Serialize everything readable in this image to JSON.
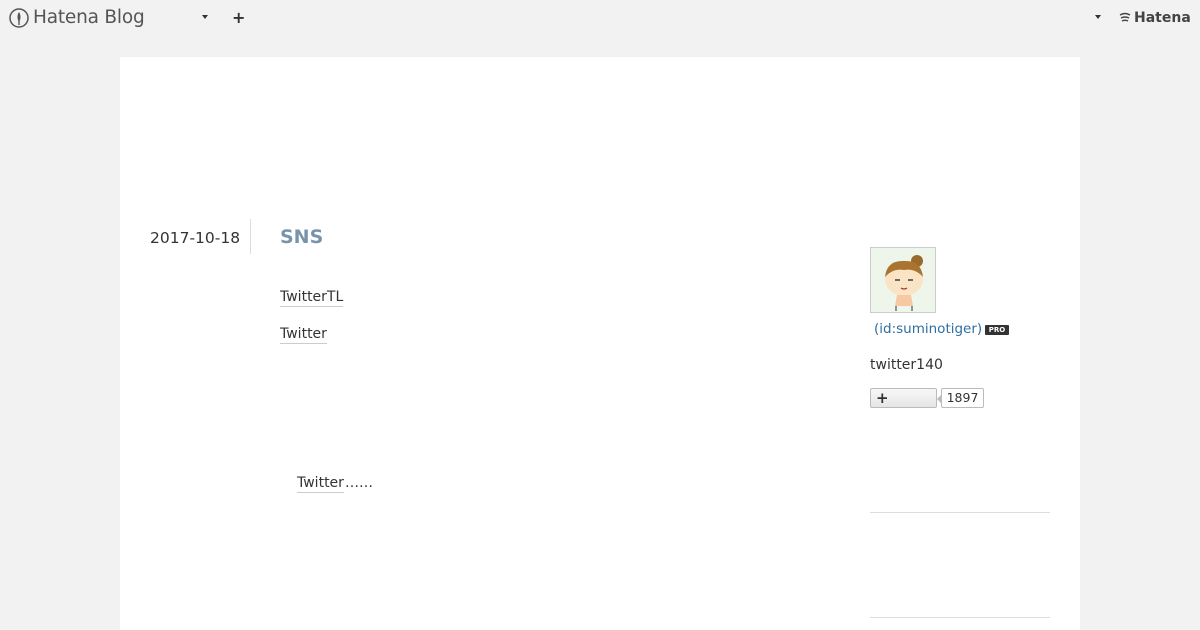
{
  "topbar": {
    "logo_text": "Hatena Blog",
    "add_label": "+",
    "hatena_text": "Hatena"
  },
  "entry": {
    "date": "2017-10-18",
    "title": "SNS",
    "links": [
      "TwitterTL",
      "Twitter",
      "Twitter"
    ],
    "trailing_text": "……"
  },
  "sidebar": {
    "user_id": "(id:suminotiger)",
    "pro_badge": "PRO",
    "description": "twitter140",
    "follow_plus": "+",
    "follower_count": "1897"
  },
  "colors": {
    "background": "#f2f2f2",
    "panel": "#ffffff",
    "title": "#7894ab",
    "link": "#2e6fa3"
  },
  "icons": [
    "hatena-blog-logo-icon",
    "caret-down-icon",
    "plus-icon",
    "hatena-logo-icon",
    "avatar-image"
  ]
}
